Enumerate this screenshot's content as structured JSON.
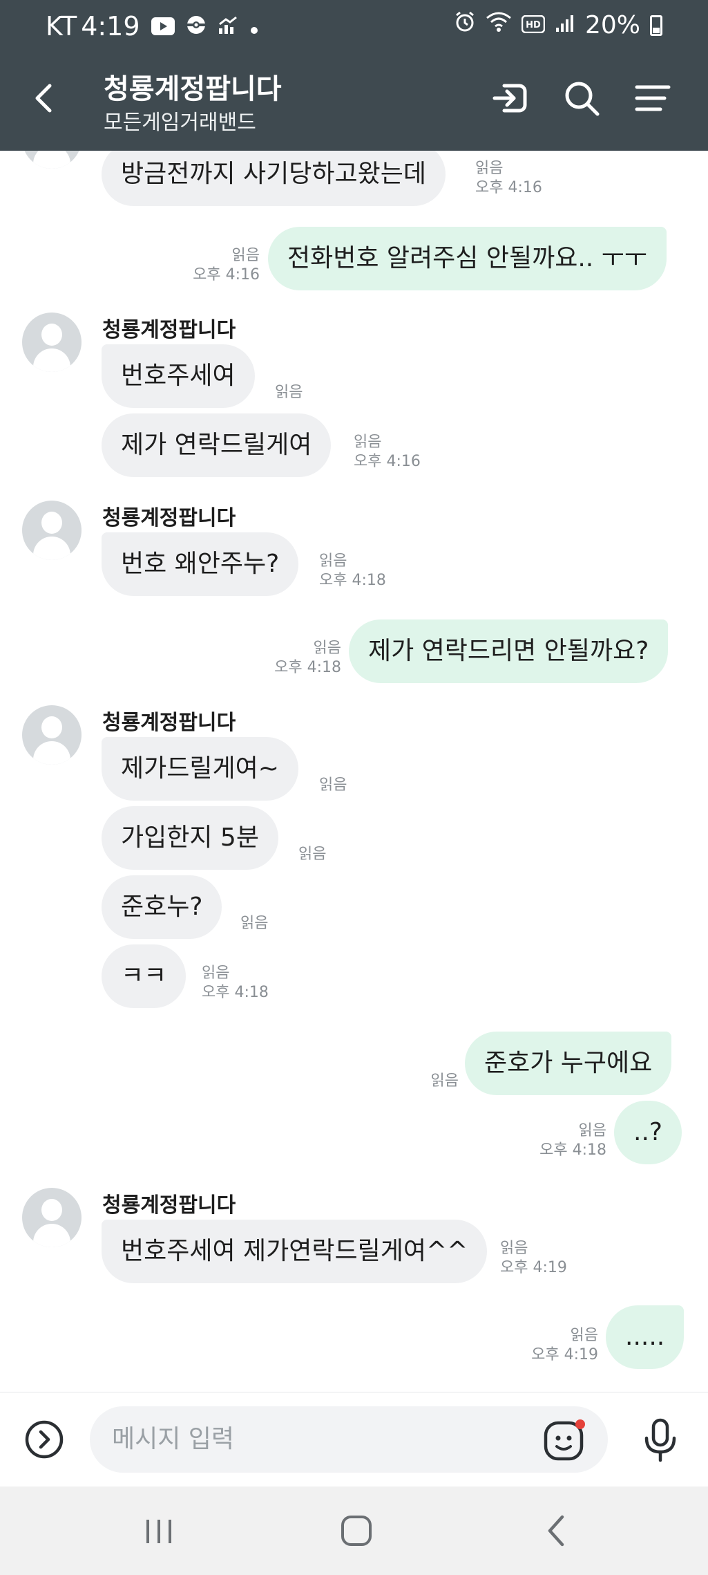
{
  "status_bar": {
    "carrier": "KT",
    "time": "4:19",
    "battery": "20%",
    "icons": [
      "youtube-icon",
      "pokeball-icon",
      "chart-icon",
      "dot-icon",
      "alarm-icon",
      "wifi-icon",
      "hd-icon",
      "signal-icon",
      "battery-icon"
    ]
  },
  "header": {
    "title": "청룡계정팝니다",
    "subtitle": "모든게임거래밴드",
    "icons": [
      "back-icon",
      "enter-icon",
      "search-icon",
      "menu-icon"
    ]
  },
  "messages": [
    {
      "id": "m1",
      "dir": "in",
      "text": "방금전까지 사기당하고왔는데",
      "read": "읽음",
      "time": "오후 4:16"
    },
    {
      "id": "m2",
      "dir": "out",
      "text": "전화번호 알려주심 안될까요.. ㅜㅜ",
      "read": "읽음",
      "time": "오후 4:16"
    },
    {
      "id": "g1",
      "sender": "청룡계정팝니다"
    },
    {
      "id": "m3",
      "dir": "in",
      "text": "번호주세여",
      "read": "읽음",
      "time": ""
    },
    {
      "id": "m4",
      "dir": "in",
      "text": "제가 연락드릴게여",
      "read": "읽음",
      "time": "오후 4:16"
    },
    {
      "id": "g2",
      "sender": "청룡계정팝니다"
    },
    {
      "id": "m5",
      "dir": "in",
      "text": "번호 왜안주누?",
      "read": "읽음",
      "time": "오후 4:18"
    },
    {
      "id": "m6",
      "dir": "out",
      "text": "제가 연락드리면 안될까요?",
      "read": "읽음",
      "time": "오후 4:18"
    },
    {
      "id": "g3",
      "sender": "청룡계정팝니다"
    },
    {
      "id": "m7",
      "dir": "in",
      "text": "제가드릴게여~",
      "read": "읽음",
      "time": ""
    },
    {
      "id": "m8",
      "dir": "in",
      "text": "가입한지 5분",
      "read": "읽음",
      "time": ""
    },
    {
      "id": "m9",
      "dir": "in",
      "text": "준호누?",
      "read": "읽음",
      "time": ""
    },
    {
      "id": "m10",
      "dir": "in",
      "text": "ㅋㅋ",
      "read": "읽음",
      "time": "오후 4:18"
    },
    {
      "id": "m11",
      "dir": "out",
      "text": "준호가 누구에요",
      "read": "읽음",
      "time": ""
    },
    {
      "id": "m12",
      "dir": "out",
      "text": "..?",
      "read": "읽음",
      "time": "오후 4:18"
    },
    {
      "id": "g4",
      "sender": "청룡계정팝니다"
    },
    {
      "id": "m13",
      "dir": "in",
      "text": "번호주세여 제가연락드릴게여^^",
      "read": "읽음",
      "time": "오후 4:19"
    },
    {
      "id": "m14",
      "dir": "out",
      "text": ".....",
      "read": "읽음",
      "time": "오후 4:19"
    }
  ],
  "input": {
    "placeholder": "메시지 입력",
    "icons": [
      "expand-icon",
      "emoji-icon",
      "mic-icon"
    ]
  },
  "nav": {
    "icons": [
      "recents-icon",
      "home-icon",
      "back-nav-icon"
    ]
  },
  "colors": {
    "header_bg": "#3f4a50",
    "incoming_bubble": "#eff0f2",
    "outgoing_bubble": "#dff5ea",
    "notification_dot": "#e5413a"
  }
}
